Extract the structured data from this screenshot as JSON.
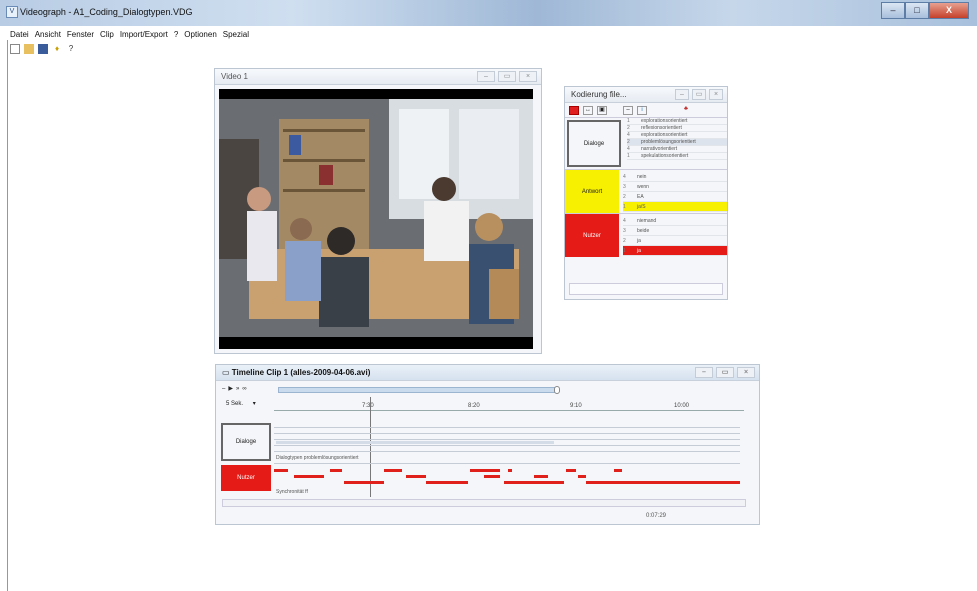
{
  "window": {
    "title": "Videograph - A1_Coding_Dialogtypen.VDG",
    "buttons": [
      "–",
      "□",
      "X"
    ]
  },
  "menu": [
    "Datei",
    "Ansicht",
    "Fenster",
    "Clip",
    "Import/Export",
    "?",
    "Optionen",
    "Spezial"
  ],
  "video_panel": {
    "title": "Video 1"
  },
  "coding_panel": {
    "title": "Kodierung file...",
    "categories": [
      {
        "label": "Dialoge",
        "color": "#f4f6f9",
        "items": [
          {
            "n": "1",
            "label": "explorationsorientiert"
          },
          {
            "n": "2",
            "label": "reflexionsorientiert"
          },
          {
            "n": "4",
            "label": "explorationsorientiert"
          },
          {
            "n": "2",
            "label": "problemlösungsorientiert"
          },
          {
            "n": "4",
            "label": "narrativorientiert"
          },
          {
            "n": "1",
            "label": "spekulationsorientiert"
          }
        ]
      },
      {
        "label": "Antwort",
        "color": "#f7f000",
        "items": [
          {
            "n": "4",
            "label": "nein"
          },
          {
            "n": "3",
            "label": "wenn"
          },
          {
            "n": "2",
            "label": "EA"
          },
          {
            "n": "1",
            "label": "ja/S"
          }
        ]
      },
      {
        "label": "Nutzer",
        "color": "#e41b17",
        "items": [
          {
            "n": "4",
            "label": "niemand"
          },
          {
            "n": "3",
            "label": "beide"
          },
          {
            "n": "2",
            "label": "ja"
          },
          {
            "n": "1",
            "label": "ja"
          }
        ]
      }
    ]
  },
  "timeline_panel": {
    "title": "Timeline Clip 1 (alles-2009-04-06.avi)",
    "zoom": "5 Sek.",
    "ticks": [
      "7:30",
      "8:20",
      "9:10",
      "10:00"
    ],
    "cursor_time": "7:30",
    "tracks": [
      {
        "label": "Dialoge",
        "caption": "Dialogtypen problemlösungsorientiert"
      },
      {
        "label": "Nutzer",
        "caption": "Synchronität ff"
      }
    ],
    "timecode": "0:07:29"
  }
}
